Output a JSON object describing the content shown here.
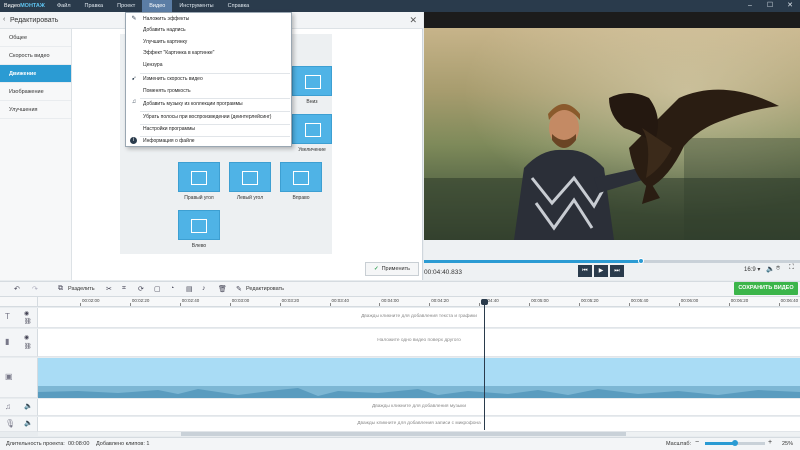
{
  "app": {
    "logo_a": "Видео",
    "logo_b": "МОНТАЖ"
  },
  "menu": [
    "Файл",
    "Правка",
    "Проект",
    "Видео",
    "Инструменты",
    "Справка"
  ],
  "window_controls": [
    "–",
    "☐",
    "✕"
  ],
  "edit_panel": {
    "title": "Редактировать",
    "back": "‹",
    "close": "✕",
    "nav": [
      "Общее",
      "Скорость видео",
      "Движение",
      "Изображение",
      "Улучшения"
    ],
    "apply_label": "Применить",
    "tiles": [
      "Вниз",
      "Увеличение",
      "Правый угол",
      "Левый угол",
      "Вправо",
      "Влево"
    ]
  },
  "dropdown": {
    "items": [
      "Наложить эффекты",
      "Добавить надпись",
      "Улучшить картинку",
      "Эффект \"Картинка в картинке\"",
      "Цензура",
      "Изменить скорость видео",
      "Поменять громкость",
      "Добавить музыку из коллекции программы",
      "Убрать полосы при воспроизведении (деинтерлейсинг)",
      "Настройки программы",
      "Информация о файле"
    ]
  },
  "player": {
    "timecode": "00:04:40.833",
    "aspect": "16:9",
    "progress": 0.578
  },
  "toolbar": {
    "split": "Разделить",
    "edit": "Редактировать",
    "save": "СОХРАНИТЬ ВИДЕО"
  },
  "ruler": [
    "00:02:00",
    "00:02:20",
    "00:02:40",
    "00:03:00",
    "00:03:20",
    "00:03:40",
    "00:04:00",
    "00:04:20",
    "00:04:40",
    "00:05:00",
    "00:05:20",
    "00:05:40",
    "00:06:00",
    "00:06:20",
    "00:06:40"
  ],
  "tracks": {
    "text_hint": "Дважды кликните для добавления текста и графики",
    "overlay_hint": "Наложите одно видео поверх другого",
    "music_hint": "Дважды кликните для добавления музыки",
    "mic_hint": "Дважды кликните для добавления записи с микрофона"
  },
  "status": {
    "duration_label": "Длительность проекта:",
    "duration_value": "00:08:00",
    "clips": "Добавлено клипов: 1",
    "zoom_label": "Масштаб:",
    "zoom_value": "25%"
  },
  "colors": {
    "accent": "#2b9bd3",
    "save": "#3bb54a",
    "titlebar": "#2a3b4c",
    "clip": "#a9dcf5"
  }
}
